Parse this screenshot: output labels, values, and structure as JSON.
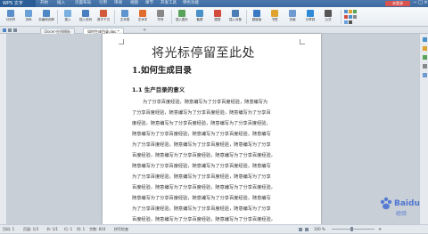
{
  "titlebar": {
    "app_button": "WPS 文字",
    "tabs": [
      "开始",
      "插入",
      "页面布局",
      "引用",
      "审阅",
      "视图",
      "章节",
      "开发工具",
      "特色功能"
    ],
    "login_label": "未登录"
  },
  "ribbon": {
    "buttons": [
      "分页符",
      "页码",
      "页眉和页脚",
      "插入",
      "插入页码",
      "首字下沉",
      "文本框",
      "艺术字",
      "符号",
      "插入图片",
      "截屏",
      "图表",
      "插入对象",
      "超链接",
      "书签",
      "页面",
      "分享到",
      "公式"
    ]
  },
  "tabbar": {
    "doc_tab_1": "Docer-在线模板",
    "doc_tab_2": "如何生成目录.doc *"
  },
  "document": {
    "title": "将光标停留至此处",
    "heading1": "1.如何生成目录",
    "heading2": "1.1 生产目录的意义",
    "lines": [
      "为了分享百度经验，随意编写为了分享百度经验，随意编写为",
      "了分享百度经验，随意编写为了分享百度经验，随意编写为了分享百",
      "度经验，随意编写为了分享百度经验，随意编写为了分享百度经验，",
      "随意编写为了分享百度经验，随意编写为了分享百度经验，随意编写",
      "为了分享百度经验，随意编写为了分享百度经验，随意编写为了分享",
      "百度经验，随意编写为了分享百度经验，随意编写为了分享百度经验，",
      "随意编写为了分享百度经验，随意编写为了分享百度经验，随意编写",
      "为了分享百度经验，随意编写为了分享百度经验，随意编写为了分享",
      "百度经验，随意编写为了分享百度经验，随意编写为了分享百度经验，",
      "随意编写为了分享百度经验，随意编写为了分享百度经验，随意编写",
      "为了分享百度经验，随意编写为了分享百度经验，随意编写为了分享",
      "百度经验，随意编写为了分享百度经验，随意编写为了分享百度经验，",
      "随意编写为了分享百度经验，随意编写为了分享百度经验，随意编写",
      "为了分享百度经验，随意编写为了分享百度经验，随意编写为了分享",
      "百度经验，随意编写为了分享百度经验，随意编写为了分享百度经验，"
    ]
  },
  "statusbar": {
    "page": "页码: 1",
    "pages": "页面: 1/3",
    "section": "节: 1/1",
    "row": "行: 1",
    "col": "列: 1",
    "words": "字数: 810",
    "spell": "拼写检查",
    "zoom": "100 %"
  },
  "watermark": {
    "brand": "Baidu",
    "sub": "经验"
  },
  "colors": {
    "title_bar": "#4c79ad",
    "login_button": "#d9534f",
    "page": "#ffffff",
    "workspace": "#c9cfd6"
  }
}
